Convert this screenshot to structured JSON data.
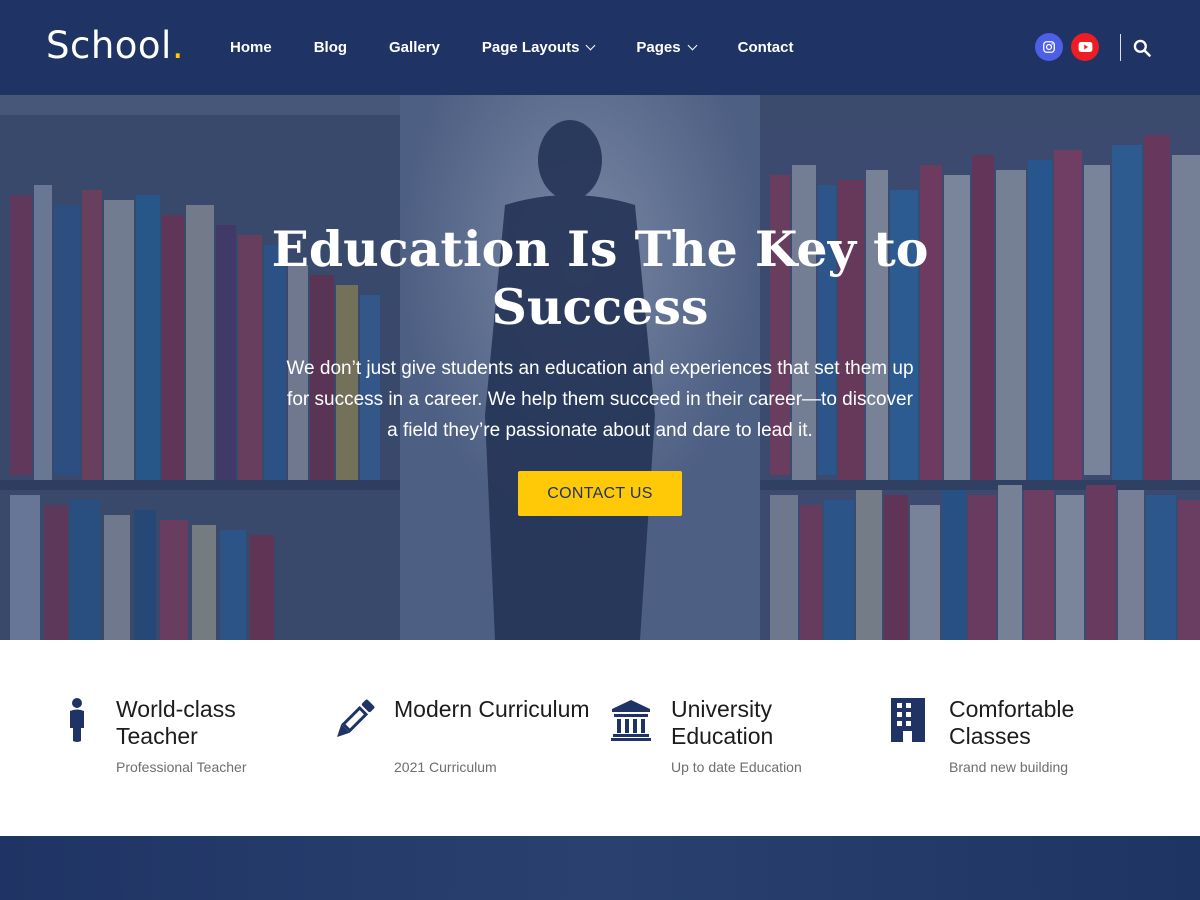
{
  "header": {
    "logo_text": "School",
    "logo_dot": ".",
    "nav": [
      {
        "label": "Home",
        "has_dropdown": false
      },
      {
        "label": "Blog",
        "has_dropdown": false
      },
      {
        "label": "Gallery",
        "has_dropdown": false
      },
      {
        "label": "Page Layouts",
        "has_dropdown": true
      },
      {
        "label": "Pages",
        "has_dropdown": true
      },
      {
        "label": "Contact",
        "has_dropdown": false
      }
    ],
    "social": [
      {
        "icon": "instagram-icon",
        "color": "#4d5fe6"
      },
      {
        "icon": "youtube-icon",
        "color": "#ee1d23"
      }
    ],
    "search_icon": "search-icon"
  },
  "hero": {
    "title": "Education Is The Key to Success",
    "text": "We don’t just give students an education and experiences that set them up for success in a career. We help them succeed in their career—to discover a field they’re passionate about and dare to lead it.",
    "cta_label": "CONTACT US"
  },
  "features": [
    {
      "icon": "person-icon",
      "title": "World-class Teacher",
      "subtitle": "Professional Teacher"
    },
    {
      "icon": "pencil-icon",
      "title": "Modern Curriculum",
      "subtitle": "2021 Curriculum"
    },
    {
      "icon": "university-icon",
      "title": "University Education",
      "subtitle": "Up to date Education"
    },
    {
      "icon": "building-icon",
      "title": "Comfortable Classes",
      "subtitle": "Brand new building"
    }
  ],
  "colors": {
    "primary": "#1f3464",
    "accent": "#ffc907",
    "instagram": "#4d5fe6",
    "youtube": "#ee1d23"
  }
}
